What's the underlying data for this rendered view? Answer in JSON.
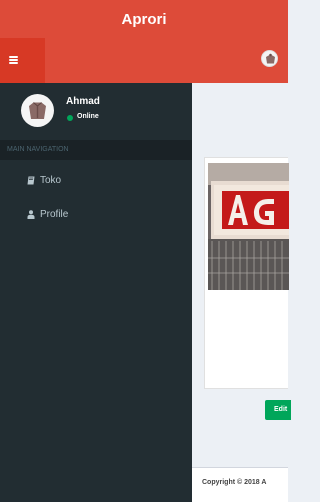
{
  "app": {
    "title": "Aprori"
  },
  "user": {
    "name": "Ahmad",
    "status": "Online"
  },
  "sidebar": {
    "header": "MAIN NAVIGATION",
    "items": [
      {
        "label": "Toko",
        "icon": "book-icon"
      },
      {
        "label": "Profile",
        "icon": "user-icon"
      }
    ]
  },
  "card": {
    "edit_label": "Edit"
  },
  "footer": {
    "text": "Copyright © 2018 A"
  },
  "colors": {
    "header": "#dd4b39",
    "sidebar": "#222d32",
    "success": "#00a65a",
    "content_bg": "#ecf0f5"
  }
}
